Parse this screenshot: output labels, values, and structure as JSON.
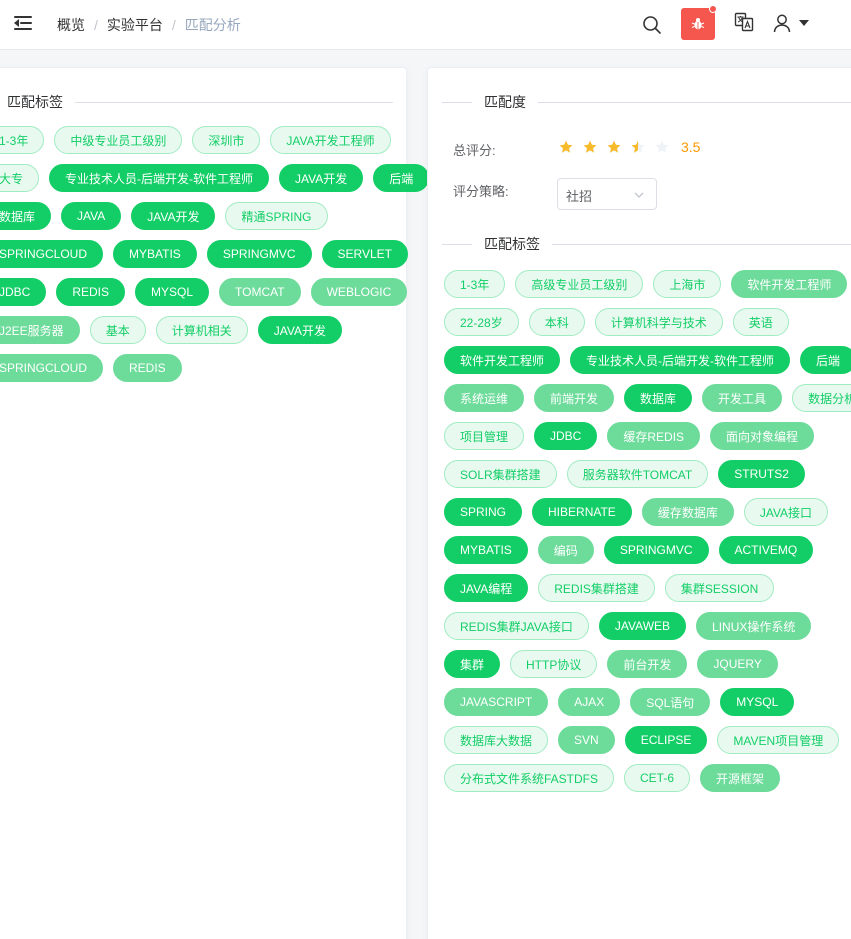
{
  "breadcrumb": {
    "items": [
      "概览",
      "实验平台",
      "匹配分析"
    ]
  },
  "left": {
    "title": "匹配标签",
    "tags": [
      {
        "text": "1-3年",
        "style": "plain"
      },
      {
        "text": "中级专业员工级别",
        "style": "plain"
      },
      {
        "text": "深圳市",
        "style": "plain"
      },
      {
        "text": "JAVA开发工程师",
        "style": "plain"
      },
      {
        "text": "大专",
        "style": "plain"
      },
      {
        "text": "专业技术人员-后端开发-软件工程师",
        "style": "dark"
      },
      {
        "text": "JAVA开发",
        "style": "dark"
      },
      {
        "text": "后端",
        "style": "dark"
      },
      {
        "text": "数据库",
        "style": "dark"
      },
      {
        "text": "JAVA",
        "style": "dark"
      },
      {
        "text": "JAVA开发",
        "style": "dark"
      },
      {
        "text": "精通SPRING",
        "style": "plain"
      },
      {
        "text": "SPRINGCLOUD",
        "style": "dark"
      },
      {
        "text": "MYBATIS",
        "style": "dark"
      },
      {
        "text": "SPRINGMVC",
        "style": "dark"
      },
      {
        "text": "SERVLET",
        "style": "dark"
      },
      {
        "text": "JDBC",
        "style": "dark"
      },
      {
        "text": "REDIS",
        "style": "dark"
      },
      {
        "text": "MYSQL",
        "style": "dark"
      },
      {
        "text": "TOMCAT",
        "style": "mid"
      },
      {
        "text": "WEBLOGIC",
        "style": "mid"
      },
      {
        "text": "J2EE服务器",
        "style": "mid"
      },
      {
        "text": "基本",
        "style": "plain"
      },
      {
        "text": "计算机相关",
        "style": "plain"
      },
      {
        "text": "JAVA开发",
        "style": "dark"
      },
      {
        "text": "SPRINGCLOUD",
        "style": "mid"
      },
      {
        "text": "REDIS",
        "style": "mid"
      }
    ]
  },
  "right": {
    "title": "匹配度",
    "score_label": "总评分:",
    "score": 3.5,
    "score_text": "3.5",
    "strategy_label": "评分策略:",
    "strategy_value": "社招",
    "tags_title": "匹配标签",
    "tags": [
      {
        "text": "1-3年",
        "style": "plain"
      },
      {
        "text": "高级专业员工级别",
        "style": "plain"
      },
      {
        "text": "上海市",
        "style": "plain"
      },
      {
        "text": "软件开发工程师",
        "style": "mid"
      },
      {
        "text": "22-28岁",
        "style": "plain"
      },
      {
        "text": "本科",
        "style": "plain"
      },
      {
        "text": "计算机科学与技术",
        "style": "plain"
      },
      {
        "text": "英语",
        "style": "plain"
      },
      {
        "text": "软件开发工程师",
        "style": "dark"
      },
      {
        "text": "专业技术人员-后端开发-软件工程师",
        "style": "dark"
      },
      {
        "text": "后端",
        "style": "dark"
      },
      {
        "text": "系统运维",
        "style": "mid"
      },
      {
        "text": "前端开发",
        "style": "mid"
      },
      {
        "text": "数据库",
        "style": "dark"
      },
      {
        "text": "开发工具",
        "style": "mid"
      },
      {
        "text": "数据分析",
        "style": "plain"
      },
      {
        "text": "项目管理",
        "style": "plain"
      },
      {
        "text": "JDBC",
        "style": "dark"
      },
      {
        "text": "缓存REDIS",
        "style": "mid"
      },
      {
        "text": "面向对象编程",
        "style": "mid"
      },
      {
        "text": "SOLR集群搭建",
        "style": "plain"
      },
      {
        "text": "服务器软件TOMCAT",
        "style": "plain"
      },
      {
        "text": "STRUTS2",
        "style": "dark"
      },
      {
        "text": "SPRING",
        "style": "dark"
      },
      {
        "text": "HIBERNATE",
        "style": "dark"
      },
      {
        "text": "缓存数据库",
        "style": "mid"
      },
      {
        "text": "JAVA接口",
        "style": "plain"
      },
      {
        "text": "MYBATIS",
        "style": "dark"
      },
      {
        "text": "编码",
        "style": "mid"
      },
      {
        "text": "SPRINGMVC",
        "style": "dark"
      },
      {
        "text": "ACTIVEMQ",
        "style": "dark"
      },
      {
        "text": "JAVA编程",
        "style": "dark"
      },
      {
        "text": "REDIS集群搭建",
        "style": "plain"
      },
      {
        "text": "集群SESSION",
        "style": "plain"
      },
      {
        "text": "REDIS集群JAVA接口",
        "style": "plain"
      },
      {
        "text": "JAVAWEB",
        "style": "dark"
      },
      {
        "text": "LINUX操作系统",
        "style": "mid"
      },
      {
        "text": "集群",
        "style": "dark"
      },
      {
        "text": "HTTP协议",
        "style": "plain"
      },
      {
        "text": "前台开发",
        "style": "mid"
      },
      {
        "text": "JQUERY",
        "style": "mid"
      },
      {
        "text": "JAVASCRIPT",
        "style": "mid"
      },
      {
        "text": "AJAX",
        "style": "mid"
      },
      {
        "text": "SQL语句",
        "style": "mid"
      },
      {
        "text": "MYSQL",
        "style": "dark"
      },
      {
        "text": "数据库大数据",
        "style": "plain"
      },
      {
        "text": "SVN",
        "style": "mid"
      },
      {
        "text": "ECLIPSE",
        "style": "dark"
      },
      {
        "text": "MAVEN项目管理",
        "style": "plain"
      },
      {
        "text": "分布式文件系统FASTDFS",
        "style": "plain"
      },
      {
        "text": "CET-6",
        "style": "plain"
      },
      {
        "text": "开源框架",
        "style": "mid"
      }
    ]
  },
  "icons": {
    "menu": "hamburger-icon",
    "search": "search-icon",
    "bug": "bug-icon",
    "language": "translate-icon",
    "user": "user-icon"
  },
  "colors": {
    "tag_dark": "#13ce66",
    "tag_mid": "#6ddb9a",
    "tag_plain_bg": "#e8faf0",
    "star": "#f7ba2a",
    "score": "#ff9900",
    "bug": "#f5564e"
  }
}
